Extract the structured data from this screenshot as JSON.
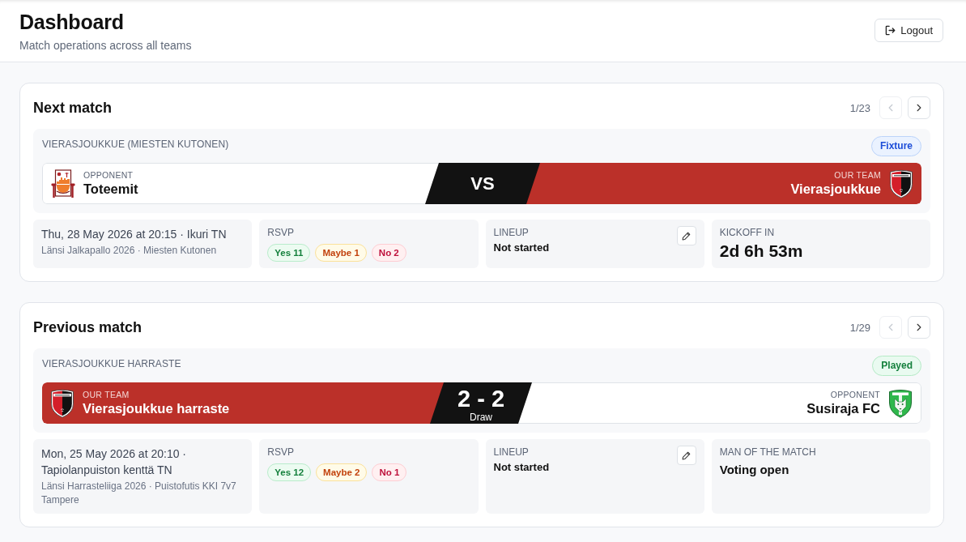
{
  "header": {
    "title": "Dashboard",
    "subtitle": "Match operations across all teams",
    "logout_button": "Logout"
  },
  "cards": [
    {
      "title": "Next match",
      "pager": {
        "position": "1/23",
        "buttons": [
          {
            "kind": "prev",
            "disabled": true
          },
          {
            "kind": "next",
            "disabled": false
          }
        ]
      },
      "competition": "VIERASJOUKKUE (MIESTEN KUTONEN)",
      "status_badge": {
        "label": "Fixture",
        "kind": "fixture"
      },
      "teams": [
        {
          "kind": "opponent",
          "role_label": "OPPONENT",
          "name": "Toteemit"
        },
        {
          "kind": "our",
          "role_label": "OUR TEAM",
          "name": "Vierasjoukkue"
        }
      ],
      "center": {
        "kind": "vs",
        "main": "VS"
      },
      "tiles": [
        {
          "kind": "schedule",
          "primary": "Thu, 28 May 2026 at 20:15 · Ikuri TN",
          "secondary": "Länsi Jalkapallo 2026 · Miesten Kutonen"
        },
        {
          "kind": "rsvp",
          "label": "RSVP",
          "chips": [
            {
              "kind": "yes",
              "label": "Yes 11"
            },
            {
              "kind": "maybe",
              "label": "Maybe 1"
            },
            {
              "kind": "no",
              "label": "No 2"
            }
          ]
        },
        {
          "kind": "lineup",
          "label": "LINEUP",
          "value": "Not started"
        },
        {
          "kind": "countdown",
          "label": "KICKOFF IN",
          "value": "2d 6h 53m"
        }
      ]
    },
    {
      "title": "Previous match",
      "pager": {
        "position": "1/29",
        "buttons": [
          {
            "kind": "prev",
            "disabled": true
          },
          {
            "kind": "next",
            "disabled": false
          }
        ]
      },
      "competition": "VIERASJOUKKUE HARRASTE",
      "status_badge": {
        "label": "Played",
        "kind": "played"
      },
      "teams": [
        {
          "kind": "our",
          "role_label": "OUR TEAM",
          "name": "Vierasjoukkue harraste"
        },
        {
          "kind": "opponent",
          "role_label": "OPPONENT",
          "name": "Susiraja FC"
        }
      ],
      "center": {
        "kind": "score",
        "main": "2 - 2",
        "result": "Draw"
      },
      "tiles": [
        {
          "kind": "schedule",
          "primary": "Mon, 25 May 2026 at 20:10 · Tapiolanpuiston kenttä TN",
          "secondary": "Länsi Harrasteliiga 2026 · Puistofutis KKI 7v7 Tampere"
        },
        {
          "kind": "rsvp",
          "label": "RSVP",
          "chips": [
            {
              "kind": "yes",
              "label": "Yes 12"
            },
            {
              "kind": "maybe",
              "label": "Maybe 2"
            },
            {
              "kind": "no",
              "label": "No 1"
            }
          ]
        },
        {
          "kind": "lineup",
          "label": "LINEUP",
          "value": "Not started"
        },
        {
          "kind": "status",
          "label": "MAN OF THE MATCH",
          "value": "Voting open"
        }
      ]
    }
  ]
}
